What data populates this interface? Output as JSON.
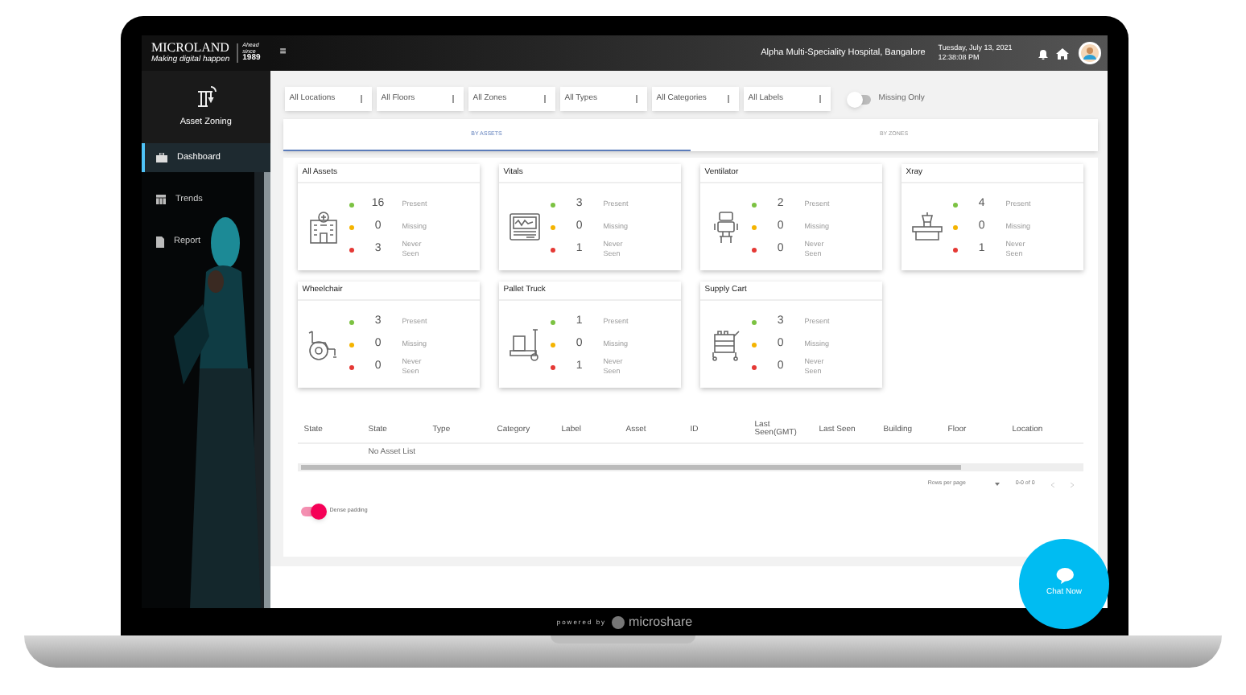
{
  "brand": {
    "name": "MICROLAND",
    "tagline": "Making digital happen",
    "since_label": "Ahead since",
    "since_year": "1989"
  },
  "sidebar": {
    "module": "Asset Zoning",
    "items": [
      {
        "label": "Dashboard",
        "selected": true
      },
      {
        "label": "Trends",
        "selected": false
      },
      {
        "label": "Report",
        "selected": false
      }
    ]
  },
  "top_bar": {
    "menu_icon": "≡",
    "hospital": "Alpha Multi-Speciality Hospital, Bangalore",
    "date": "Tuesday, July 13, 2021",
    "time": "12:38:08 PM"
  },
  "filters": [
    {
      "value": "All Locations"
    },
    {
      "value": "All Floors"
    },
    {
      "value": "All Zones"
    },
    {
      "value": "All Types"
    },
    {
      "value": "All Categories"
    },
    {
      "value": "All Labels"
    }
  ],
  "missing_only": {
    "label": "Missing Only",
    "on": false
  },
  "tabs": [
    {
      "label": "BY ASSETS",
      "selected": true
    },
    {
      "label": "BY ZONES",
      "selected": false
    }
  ],
  "cards": [
    {
      "title": "All Assets",
      "rows": [
        {
          "count": "16",
          "label": "Present",
          "color": "#7cc242"
        },
        {
          "count": "0",
          "label": "Missing",
          "color": "#f5b400"
        },
        {
          "count": "3",
          "label": "Never Seen",
          "color": "#e53935"
        }
      ]
    },
    {
      "title": "Vitals",
      "rows": [
        {
          "count": "3",
          "label": "Present",
          "color": "#7cc242"
        },
        {
          "count": "0",
          "label": "Missing",
          "color": "#f5b400"
        },
        {
          "count": "1",
          "label": "Never Seen",
          "color": "#e53935"
        }
      ]
    },
    {
      "title": "Ventilator",
      "rows": [
        {
          "count": "2",
          "label": "Present",
          "color": "#7cc242"
        },
        {
          "count": "0",
          "label": "Missing",
          "color": "#f5b400"
        },
        {
          "count": "0",
          "label": "Never Seen",
          "color": "#e53935"
        }
      ]
    },
    {
      "title": "Xray",
      "rows": [
        {
          "count": "4",
          "label": "Present",
          "color": "#7cc242"
        },
        {
          "count": "0",
          "label": "Missing",
          "color": "#f5b400"
        },
        {
          "count": "1",
          "label": "Never Seen",
          "color": "#e53935"
        }
      ]
    },
    {
      "title": "Wheelchair",
      "rows": [
        {
          "count": "3",
          "label": "Present",
          "color": "#7cc242"
        },
        {
          "count": "0",
          "label": "Missing",
          "color": "#f5b400"
        },
        {
          "count": "0",
          "label": "Never Seen",
          "color": "#e53935"
        }
      ]
    },
    {
      "title": "Pallet Truck",
      "rows": [
        {
          "count": "1",
          "label": "Present",
          "color": "#7cc242"
        },
        {
          "count": "0",
          "label": "Missing",
          "color": "#f5b400"
        },
        {
          "count": "1",
          "label": "Never Seen",
          "color": "#e53935"
        }
      ]
    },
    {
      "title": "Supply Cart",
      "rows": [
        {
          "count": "3",
          "label": "Present",
          "color": "#7cc242"
        },
        {
          "count": "0",
          "label": "Missing",
          "color": "#f5b400"
        },
        {
          "count": "0",
          "label": "Never Seen",
          "color": "#e53935"
        }
      ]
    }
  ],
  "table": {
    "columns": [
      "State",
      "State",
      "Type",
      "Category",
      "Label",
      "Asset",
      "ID",
      "Last Seen(GMT)",
      "Last Seen",
      "Building",
      "Floor",
      "Location"
    ],
    "empty_message": "No Asset List"
  },
  "pagination": {
    "rows_per_page": "Rows per page",
    "range": "0-0 of 0"
  },
  "dense_padding": {
    "label": "Dense padding",
    "on": true
  },
  "chat": {
    "label": "Chat Now"
  },
  "footer": {
    "powered_by": "powered by",
    "brand": "microshare"
  }
}
